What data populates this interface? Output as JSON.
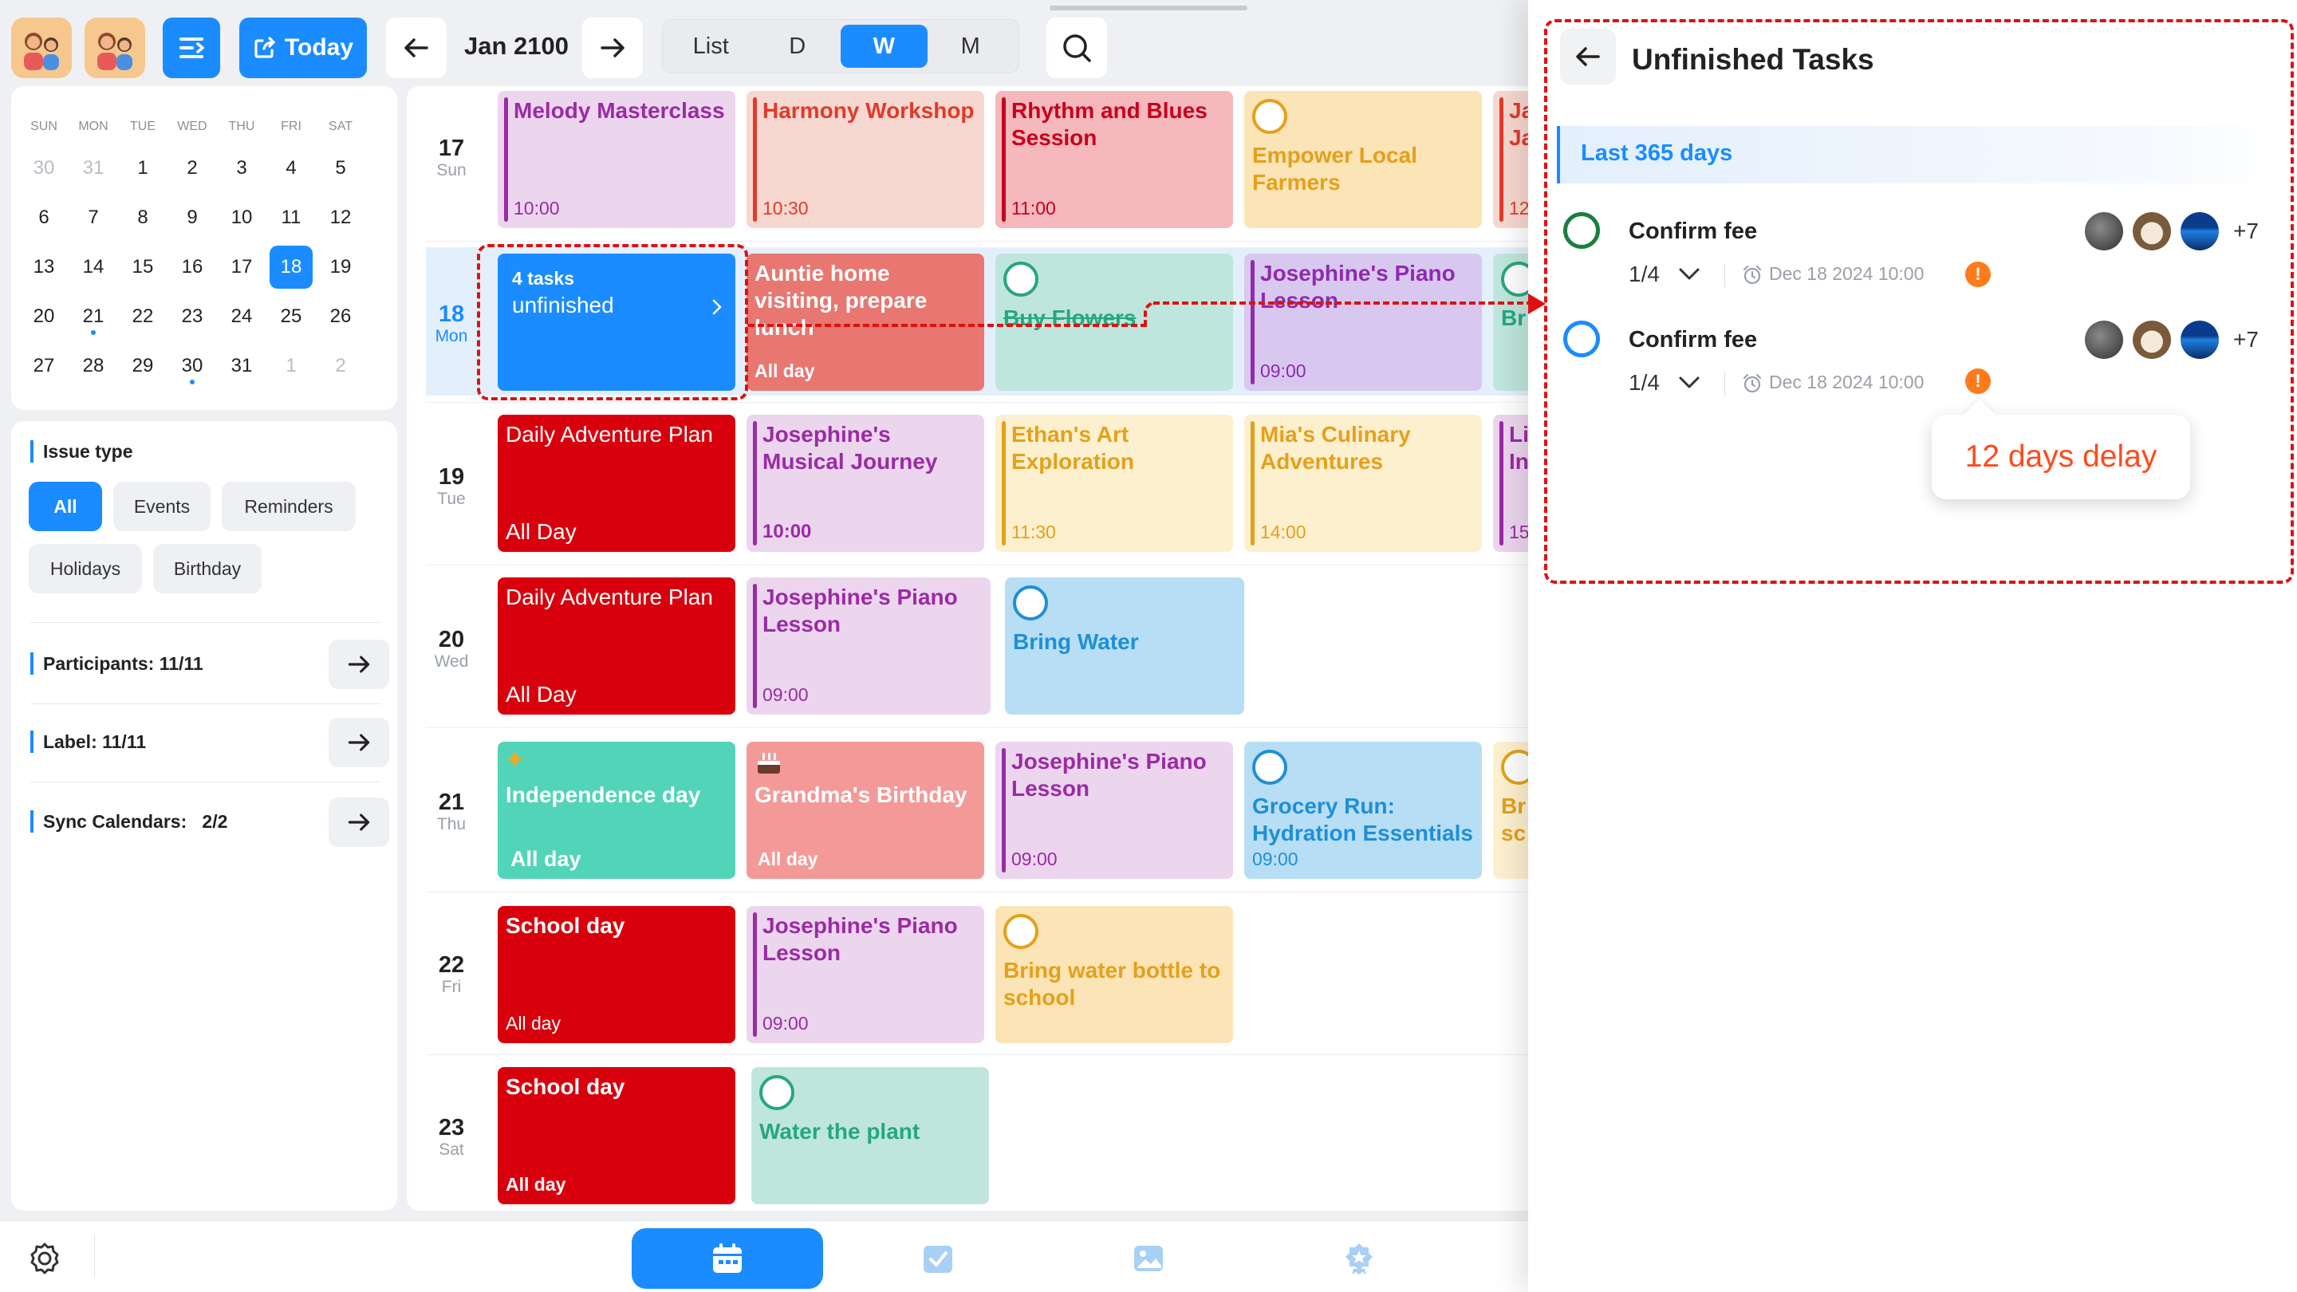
{
  "header": {
    "today_label": "Today",
    "month": "Jan 2100",
    "views": [
      "List",
      "D",
      "W",
      "M"
    ],
    "active_view": "W"
  },
  "mini_calendar": {
    "dow": [
      "SUN",
      "MON",
      "TUE",
      "WED",
      "THU",
      "FRI",
      "SAT"
    ],
    "weeks": [
      [
        "30",
        "31",
        "1",
        "2",
        "3",
        "4",
        "5"
      ],
      [
        "6",
        "7",
        "8",
        "9",
        "10",
        "11",
        "12"
      ],
      [
        "13",
        "14",
        "15",
        "16",
        "17",
        "18",
        "19"
      ],
      [
        "20",
        "21",
        "22",
        "23",
        "24",
        "25",
        "26"
      ],
      [
        "27",
        "28",
        "29",
        "30",
        "31",
        "1",
        "2"
      ]
    ],
    "selected": "18"
  },
  "filters": {
    "issue_type_title": "Issue type",
    "chips": [
      "All",
      "Events",
      "Reminders",
      "Holidays",
      "Birthday"
    ],
    "active_chip": "All",
    "participants": "Participants: 11/11",
    "label": "Label: 11/11",
    "sync_label": "Sync Calendars:",
    "sync_value": "2/2"
  },
  "days": [
    {
      "num": "17",
      "dow": "Sun"
    },
    {
      "num": "18",
      "dow": "Mon"
    },
    {
      "num": "19",
      "dow": "Tue"
    },
    {
      "num": "20",
      "dow": "Wed"
    },
    {
      "num": "21",
      "dow": "Thu"
    },
    {
      "num": "22",
      "dow": "Fri"
    },
    {
      "num": "23",
      "dow": "Sat"
    }
  ],
  "events": {
    "d17": [
      {
        "title": "Melody Masterclass",
        "time": "10:00"
      },
      {
        "title": "Harmony Workshop",
        "time": "10:30"
      },
      {
        "title": "Rhythm and Blues Session",
        "time": "11:00"
      },
      {
        "title": "Empower Local Farmers"
      },
      {
        "title": "Ja Ja",
        "time": "12"
      }
    ],
    "d18": [
      {
        "count": "4 tasks",
        "label": "unfinished"
      },
      {
        "title": "Auntie home visiting, prepare lunch",
        "time": "All day"
      },
      {
        "title": "Buy Flowers"
      },
      {
        "title": "Josephine's Piano Lesson",
        "time": "09:00"
      },
      {
        "title": "Br"
      }
    ],
    "d19": [
      {
        "title": "Daily Adventure Plan",
        "time": "All Day"
      },
      {
        "title": "Josephine's Musical Journey",
        "time": "10:00"
      },
      {
        "title": "Ethan's Art Exploration",
        "time": "11:30"
      },
      {
        "title": "Mia's Culinary Adventures",
        "time": "14:00"
      },
      {
        "title": "Li In",
        "time": "15"
      }
    ],
    "d20": [
      {
        "title": "Daily Adventure Plan",
        "time": "All Day"
      },
      {
        "title": "Josephine's Piano Lesson",
        "time": "09:00"
      },
      {
        "title": "Bring Water"
      }
    ],
    "d21": [
      {
        "title": "Independence day",
        "time": "All day"
      },
      {
        "title": "Grandma's Birthday",
        "time": "All day"
      },
      {
        "title": "Josephine's Piano Lesson",
        "time": "09:00"
      },
      {
        "title": "Grocery Run: Hydration Essentials",
        "time": "09:00"
      },
      {
        "title": "Br sc"
      }
    ],
    "d22": [
      {
        "title": "School day",
        "time": "All day"
      },
      {
        "title": "Josephine's Piano Lesson",
        "time": "09:00"
      },
      {
        "title": "Bring water bottle to school"
      }
    ],
    "d23": [
      {
        "title": "School day",
        "time": "All day"
      },
      {
        "title": "Water the plant"
      }
    ]
  },
  "panel": {
    "title": "Unfinished Tasks",
    "range": "Last 365 days",
    "tasks": [
      {
        "name": "Confirm fee",
        "progress": "1/4",
        "due": "Dec 18 2024 10:00",
        "more": "+7",
        "ring_color": "#1a7f3c"
      },
      {
        "name": "Confirm fee",
        "progress": "1/4",
        "due": "Dec 18 2024 10:00",
        "more": "+7",
        "ring_color": "#1a8cff"
      }
    ],
    "tooltip": "12 days delay"
  },
  "colors": {
    "accent": "#1a8cff",
    "annotation": "#e01010",
    "warning": "#ff7a1a"
  }
}
